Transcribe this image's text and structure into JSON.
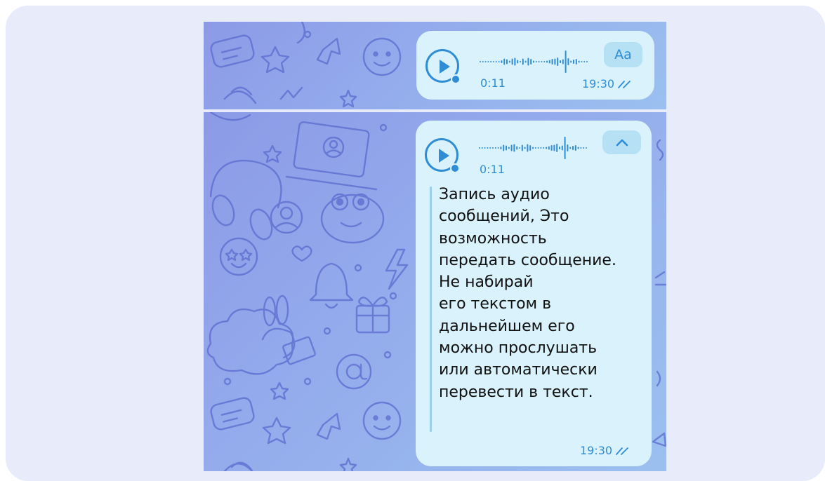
{
  "colors": {
    "accent": "#2f8dd6",
    "bubble": "#daf2fb",
    "background_gradient_start": "#8c9ae6",
    "background_gradient_end": "#9bc0ef",
    "outer_card": "#e8ebfa"
  },
  "icons": {
    "play": "play-triangle",
    "read_status": "double-check-mark",
    "collapse": "chevron-up",
    "unread_dot": "blue-dot"
  },
  "top_message": {
    "duration": "0:11",
    "time": "19:30",
    "transcribe_label": "Aa"
  },
  "bottom_message": {
    "duration": "0:11",
    "time": "19:30",
    "transcript_lines": [
      "Запись аудио",
      "сообщений, Это",
      "возможность",
      "передать сообщение.",
      "Не набирай",
      "его текстом в",
      "дальнейшем его",
      "можно прослушать",
      "или автоматически",
      "перевести в текст."
    ]
  }
}
